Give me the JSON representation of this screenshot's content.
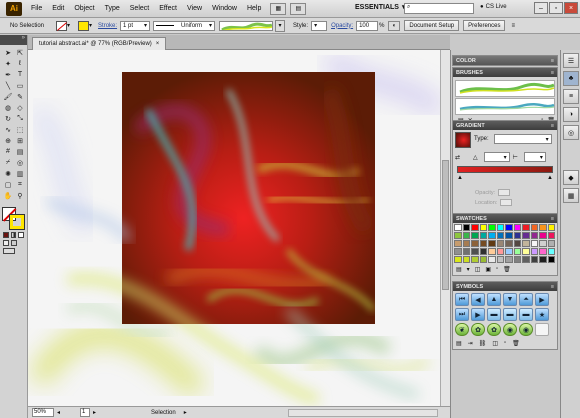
{
  "app": {
    "logo": "Ai",
    "menus": [
      "File",
      "Edit",
      "Object",
      "Type",
      "Select",
      "Effect",
      "View",
      "Window",
      "Help"
    ],
    "workspace": "ESSENTIALS",
    "cs_live": "CS Live",
    "search_placeholder": ""
  },
  "control": {
    "selection_label": "No Selection",
    "stroke_label": "Stroke:",
    "stroke_weight": "1 pt",
    "stroke_profile": "Uniform",
    "style_label": "Style:",
    "opacity_label": "Opacity:",
    "opacity_value": "100",
    "opacity_unit": "%",
    "document_setup": "Document Setup",
    "preferences": "Preferences"
  },
  "document": {
    "tab_title": "tutorial abstract.ai* @ 77% (RGB/Preview)",
    "tab_close": "×"
  },
  "status": {
    "zoom": "50%",
    "page": "1",
    "tool": "Selection"
  },
  "panels": {
    "color": {
      "title": "COLOR"
    },
    "brushes": {
      "title": "BRUSHES"
    },
    "gradient": {
      "title": "GRADIENT",
      "type_label": "Type:",
      "stroke_angle_label": "",
      "opacity_label": "Opacity:",
      "location_label": "Location:"
    },
    "swatches": {
      "title": "SWATCHES"
    },
    "symbols": {
      "title": "SYMBOLS"
    }
  },
  "colors": {
    "accent_yellow": "#ffe600",
    "gradient_start": "#e22222",
    "gradient_end": "#8a1a10"
  },
  "swatches": [
    "#ffffff",
    "#000000",
    "#ff0000",
    "#ffff00",
    "#00ff00",
    "#00ffff",
    "#0000ff",
    "#ff00ff",
    "#ed1c24",
    "#f26522",
    "#f7941d",
    "#fff200",
    "#8dc63f",
    "#39b54a",
    "#00a651",
    "#00a99d",
    "#00aeef",
    "#0072bc",
    "#0054a6",
    "#2e3192",
    "#662d91",
    "#92278f",
    "#ec008c",
    "#ed145b",
    "#c69c6d",
    "#a67c52",
    "#8c6239",
    "#754c24",
    "#603913",
    "#998675",
    "#736357",
    "#534741",
    "#c2b59b",
    "#f5f5f5",
    "#d0d0d0",
    "#b0b0b0",
    "#909090",
    "#707070",
    "#505050",
    "#303030",
    "#ffcc99",
    "#ff9999",
    "#99ccff",
    "#99ff99",
    "#ffff99",
    "#cc99ff",
    "#ff66cc",
    "#66ffff",
    "#d8e81a",
    "#ccdd22",
    "#b0cc33",
    "#99bb33",
    "#e8e8e8",
    "#c0c0c0",
    "#a0a0a0",
    "#808080",
    "#606060",
    "#404040",
    "#202020",
    "#000000"
  ]
}
